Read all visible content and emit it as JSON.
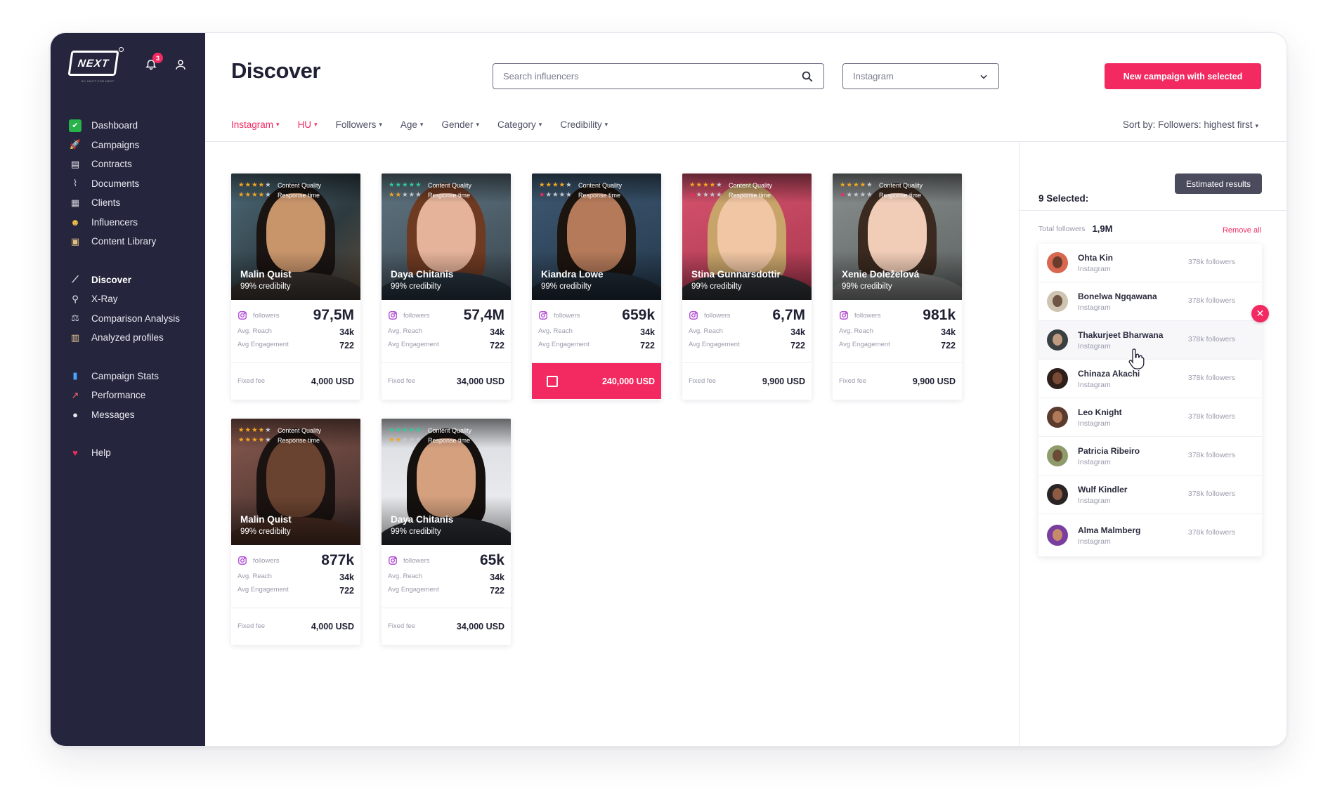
{
  "sidebar": {
    "logo": "NEXT",
    "logo_sub": "BY KNOT FOR NEXT",
    "notification_count": "3",
    "items": [
      {
        "label": "Dashboard",
        "icon": "checkbox-icon"
      },
      {
        "label": "Campaigns",
        "icon": "rocket-icon"
      },
      {
        "label": "Contracts",
        "icon": "document-icon"
      },
      {
        "label": "Documents",
        "icon": "paperclip-icon"
      },
      {
        "label": "Clients",
        "icon": "building-icon"
      },
      {
        "label": "Influencers",
        "icon": "sunglasses-face-icon"
      },
      {
        "label": "Content Library",
        "icon": "camera-icon"
      },
      {
        "label": "Discover",
        "icon": "telescope-icon"
      },
      {
        "label": "X-Ray",
        "icon": "magnifier-icon"
      },
      {
        "label": "Comparison Analysis",
        "icon": "scales-icon"
      },
      {
        "label": "Analyzed profiles",
        "icon": "clipboard-icon"
      },
      {
        "label": "Campaign Stats",
        "icon": "bar-chart-icon"
      },
      {
        "label": "Performance",
        "icon": "line-chart-icon"
      },
      {
        "label": "Messages",
        "icon": "speech-bubble-icon"
      },
      {
        "label": "Help",
        "icon": "heart-icon"
      }
    ]
  },
  "header": {
    "title": "Discover",
    "search_placeholder": "Search influencers",
    "platform": "Instagram",
    "cta": "New campaign with selected"
  },
  "filters": [
    "Instagram",
    "HU",
    "Followers",
    "Age",
    "Gender",
    "Category",
    "Credibility"
  ],
  "sort": "Sort by: Followers: highest first",
  "card_labels": {
    "content_quality": "Content Quality",
    "response_time": "Response time",
    "followers": "followers",
    "avg_reach": "Avg. Reach",
    "avg_engagement": "Avg Engagement",
    "fixed_fee": "Fixed fee"
  },
  "cards": [
    {
      "name": "Malin Quist",
      "credibility": "99% credibilty",
      "followers": "97,5M",
      "reach": "34k",
      "engagement": "722",
      "fee": "4,000 USD",
      "selected": false,
      "quality_stars": 4,
      "response_stars": 4
    },
    {
      "name": "Daya Chitanis",
      "credibility": "99% credibilty",
      "followers": "57,4M",
      "reach": "34k",
      "engagement": "722",
      "fee": "34,000 USD",
      "selected": false,
      "quality_stars": 5,
      "response_stars": 2
    },
    {
      "name": "Kiandra Lowe",
      "credibility": "99% credibilty",
      "followers": "659k",
      "reach": "34k",
      "engagement": "722",
      "fee": "240,000 USD",
      "selected": true,
      "quality_stars": 4,
      "response_stars": 1
    },
    {
      "name": "Stina Gunnarsdottir",
      "credibility": "99% credibilty",
      "followers": "6,7M",
      "reach": "34k",
      "engagement": "722",
      "fee": "9,900 USD",
      "selected": false,
      "quality_stars": 4,
      "response_stars": 1
    },
    {
      "name": "Xenie Doleželová",
      "credibility": "99% credibilty",
      "followers": "981k",
      "reach": "34k",
      "engagement": "722",
      "fee": "9,900 USD",
      "selected": false,
      "quality_stars": 4,
      "response_stars": 1
    },
    {
      "name": "Malin Quist",
      "credibility": "99% credibilty",
      "followers": "877k",
      "reach": "34k",
      "engagement": "722",
      "fee": "4,000 USD",
      "selected": false,
      "quality_stars": 4,
      "response_stars": 4
    },
    {
      "name": "Daya Chitanis",
      "credibility": "99% credibilty",
      "followers": "65k",
      "reach": "34k",
      "engagement": "722",
      "fee": "34,000 USD",
      "selected": false,
      "quality_stars": 5,
      "response_stars": 2
    }
  ],
  "panel": {
    "estimated_button": "Estimated results",
    "selected_count": "9 Selected:",
    "total_label": "Total followers",
    "total_value": "1,9M",
    "remove_all": "Remove all",
    "items": [
      {
        "name": "Ohta Kin",
        "platform": "Instagram",
        "followers": "378k followers"
      },
      {
        "name": "Bonelwa Ngqawana",
        "platform": "Instagram",
        "followers": "378k followers"
      },
      {
        "name": "Thakurjeet Bharwana",
        "platform": "Instagram",
        "followers": "378k followers"
      },
      {
        "name": "Chinaza Akachi",
        "platform": "Instagram",
        "followers": "378k followers"
      },
      {
        "name": "Leo Knight",
        "platform": "Instagram",
        "followers": "378k followers"
      },
      {
        "name": "Patricia Ribeiro",
        "platform": "Instagram",
        "followers": "378k followers"
      },
      {
        "name": "Wulf Kindler",
        "platform": "Instagram",
        "followers": "378k followers"
      },
      {
        "name": "Alma Malmberg",
        "platform": "Instagram",
        "followers": "378k followers"
      }
    ]
  },
  "colors": {
    "accent": "#f22a61",
    "sidebar_bg": "#25263d",
    "star_gold": "#f5a623",
    "star_green": "#2ecc9a",
    "star_red": "#f22a61"
  }
}
